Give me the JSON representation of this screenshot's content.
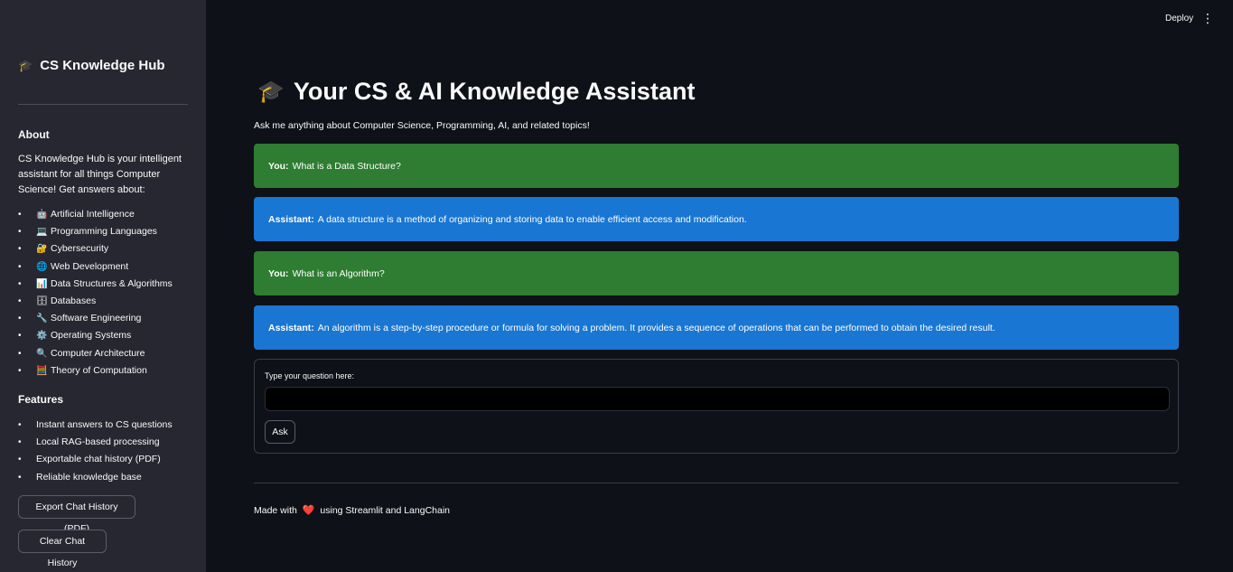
{
  "sidebar": {
    "title_icon": "🎓",
    "title": "CS Knowledge Hub",
    "about_heading": "About",
    "about_text": "CS Knowledge Hub is your intelligent assistant for all things Computer Science! Get answers about:",
    "topics": [
      {
        "icon": "🤖",
        "label": "Artificial Intelligence"
      },
      {
        "icon": "💻",
        "label": "Programming Languages"
      },
      {
        "icon": "🔐",
        "label": "Cybersecurity"
      },
      {
        "icon": "🌐",
        "label": "Web Development"
      },
      {
        "icon": "📊",
        "label": "Data Structures & Algorithms"
      },
      {
        "icon": "🗄",
        "label": "Databases"
      },
      {
        "icon": "🔧",
        "label": "Software Engineering"
      },
      {
        "icon": "⚙️",
        "label": "Operating Systems"
      },
      {
        "icon": "🔍",
        "label": "Computer Architecture"
      },
      {
        "icon": "🧮",
        "label": "Theory of Computation"
      }
    ],
    "features_heading": "Features",
    "features": [
      "Instant answers to CS questions",
      "Local RAG-based processing",
      "Exportable chat history (PDF)",
      "Reliable knowledge base"
    ],
    "export_button": "Export Chat History (PDF)",
    "clear_button": "Clear Chat History"
  },
  "header": {
    "deploy_label": "Deploy",
    "menu_icon": "⋮"
  },
  "main": {
    "title_icon": "🎓",
    "title": "Your CS & AI Knowledge Assistant",
    "subtitle": "Ask me anything about Computer Science, Programming, AI, and related topics!",
    "messages": [
      {
        "role": "You:",
        "text": "What is a Data Structure?"
      },
      {
        "role": "Assistant:",
        "text": "A data structure is a method of organizing and storing data to enable efficient access and modification."
      },
      {
        "role": "You:",
        "text": "What is an Algorithm?"
      },
      {
        "role": "Assistant:",
        "text": "An algorithm is a step-by-step procedure or formula for solving a problem. It provides a sequence of operations that can be performed to obtain the desired result."
      }
    ],
    "input_label": "Type your question here:",
    "input_value": "",
    "ask_button": "Ask",
    "footer_prefix": "Made with",
    "footer_heart": "❤️",
    "footer_suffix": "using Streamlit and LangChain"
  },
  "colors": {
    "background": "#0e1117",
    "sidebar": "#262730",
    "user_message": "#2e7d32",
    "assistant_message": "#1976d2"
  }
}
